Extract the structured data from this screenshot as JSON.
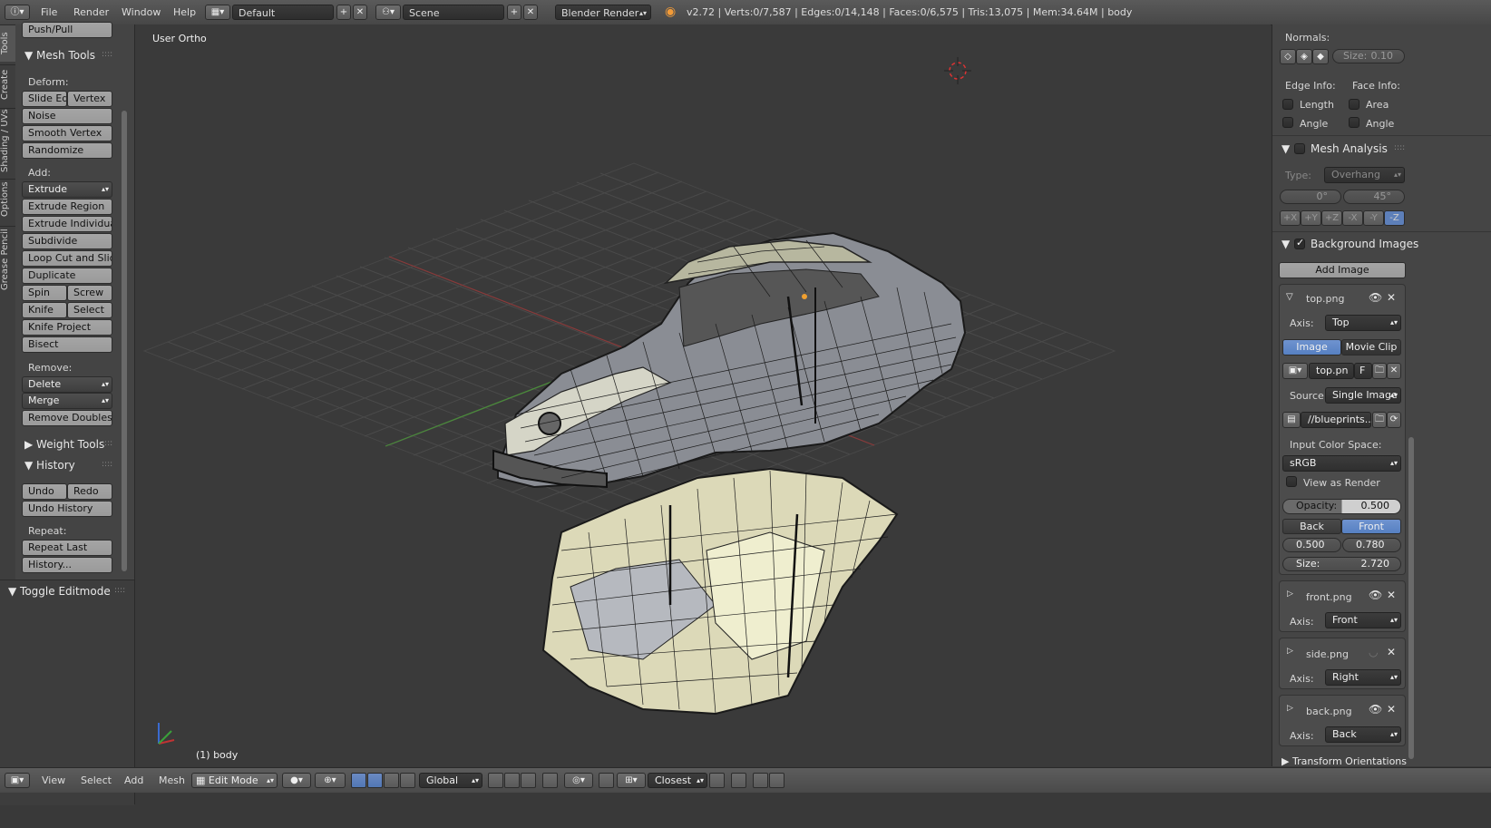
{
  "header": {
    "menus": [
      "File",
      "Render",
      "Window",
      "Help"
    ],
    "layout_name": "Default",
    "scene_name": "Scene",
    "render_engine": "Blender Render",
    "stats": "v2.72 | Verts:0/7,587 | Edges:0/14,148 | Faces:0/6,575 | Tris:13,075 | Mem:34.64M | body"
  },
  "left_tabs": [
    "Tools",
    "Create",
    "Shading / UVs",
    "Options",
    "Grease Pencil"
  ],
  "toolshelf": {
    "push_pull": "Push/Pull",
    "mesh_tools": "Mesh Tools",
    "deform_label": "Deform:",
    "slide_edge": "Slide Ed",
    "vertex": "Vertex",
    "noise": "Noise",
    "smooth_vertex": "Smooth Vertex",
    "randomize": "Randomize",
    "add_label": "Add:",
    "extrude": "Extrude",
    "extrude_region": "Extrude Region",
    "extrude_individual": "Extrude Individual",
    "subdivide": "Subdivide",
    "loop_cut": "Loop Cut and Slide",
    "duplicate": "Duplicate",
    "spin": "Spin",
    "screw": "Screw",
    "knife": "Knife",
    "select": "Select",
    "knife_project": "Knife Project",
    "bisect": "Bisect",
    "remove_label": "Remove:",
    "delete": "Delete",
    "merge": "Merge",
    "remove_doubles": "Remove Doubles",
    "weight_tools": "Weight Tools",
    "history": "History",
    "undo": "Undo",
    "redo": "Redo",
    "undo_history": "Undo History",
    "repeat_label": "Repeat:",
    "repeat_last": "Repeat Last",
    "history_btn": "History...",
    "toggle_editmode": "Toggle Editmode"
  },
  "viewport": {
    "view_name": "User Ortho",
    "object_label": "(1) body"
  },
  "right_panel": {
    "normals_label": "Normals:",
    "size_label": "Size:",
    "size_value": "0.10",
    "edge_info": "Edge Info:",
    "face_info": "Face Info:",
    "length": "Length",
    "area": "Area",
    "angle1": "Angle",
    "angle2": "Angle",
    "mesh_analysis": "Mesh Analysis",
    "type_label": "Type:",
    "type_value": "Overhang",
    "min_angle": "0°",
    "max_angle": "45°",
    "axes": [
      "+X",
      "+Y",
      "+Z",
      "-X",
      "-Y",
      "-Z"
    ],
    "background_images": "Background Images",
    "add_image": "Add Image",
    "img1": {
      "name": "top.png",
      "axis_label": "Axis:",
      "axis_value": "Top",
      "tab_image": "Image",
      "tab_movie": "Movie Clip",
      "file_short": "top.pn",
      "f_flag": "F",
      "source_label": "Source",
      "source_value": "Single Image",
      "path": "//blueprints...",
      "color_space_label": "Input Color Space:",
      "color_space_value": "sRGB",
      "view_as_render": "View as Render",
      "opacity_label": "Opacity:",
      "opacity_value": "0.500",
      "back": "Back",
      "front": "Front",
      "offset_x": "0.500",
      "offset_y": "0.780",
      "size_label": "Size:",
      "size_value": "2.720"
    },
    "img2": {
      "name": "front.png",
      "axis_label": "Axis:",
      "axis_value": "Front"
    },
    "img3": {
      "name": "side.png",
      "axis_label": "Axis:",
      "axis_value": "Right"
    },
    "img4": {
      "name": "back.png",
      "axis_label": "Axis:",
      "axis_value": "Back"
    },
    "transform_orientations": "Transform Orientations"
  },
  "footer": {
    "menus": [
      "View",
      "Select",
      "Add",
      "Mesh"
    ],
    "mode": "Edit Mode",
    "orientation": "Global",
    "snap_target": "Closest"
  }
}
